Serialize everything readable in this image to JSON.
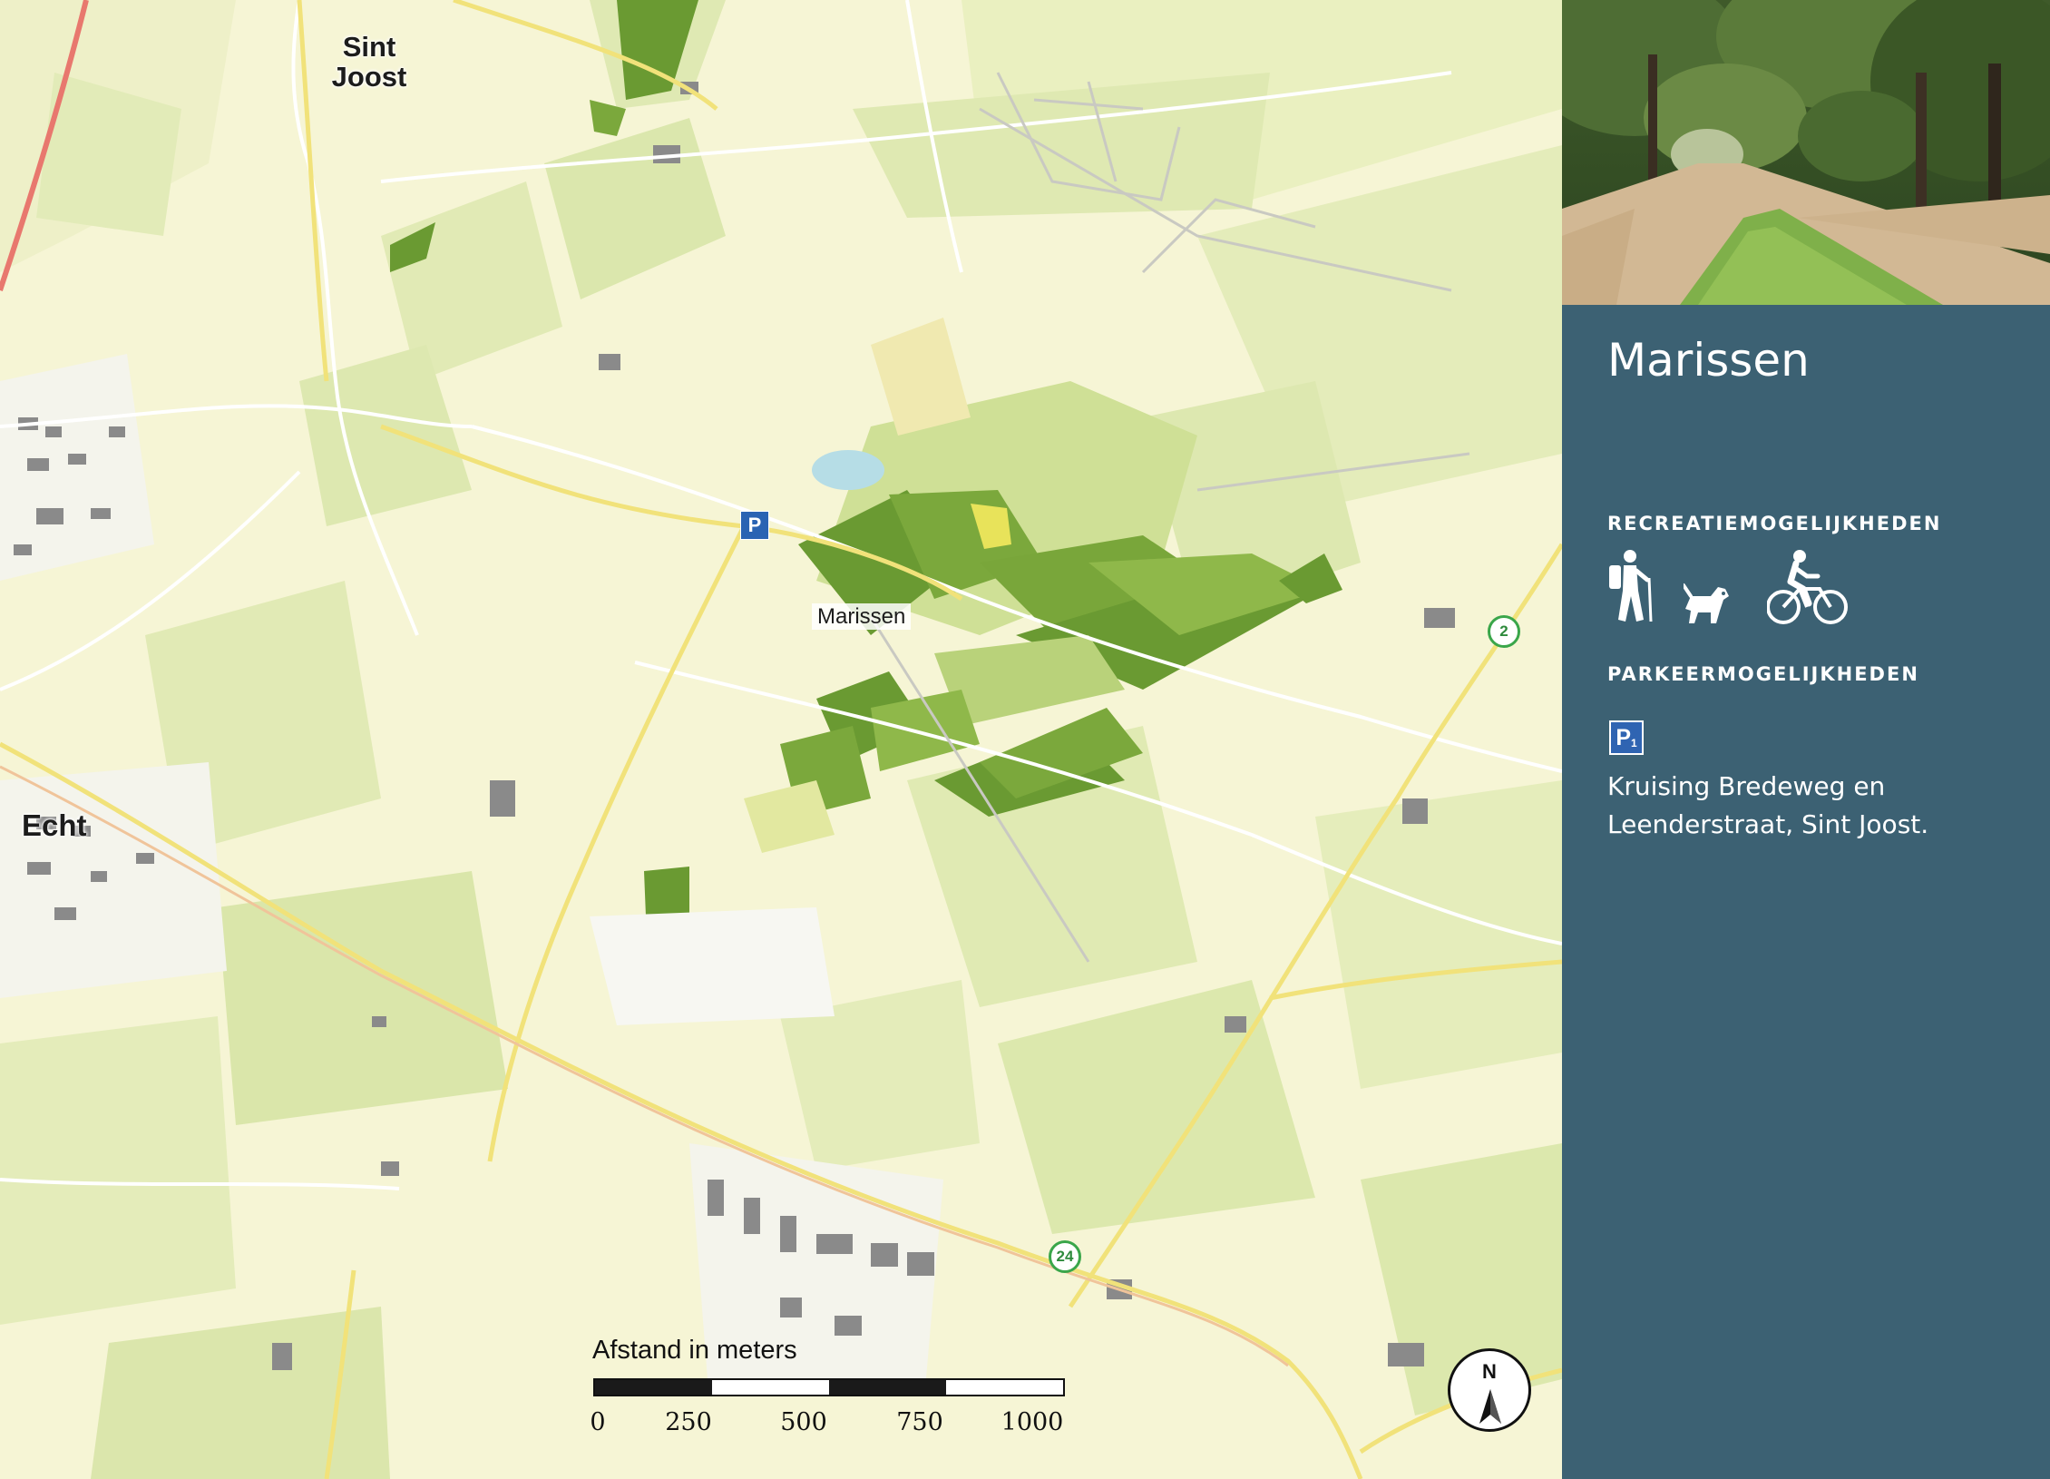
{
  "map": {
    "places": {
      "sint_joost": "Sint Joost",
      "echt": "Echt",
      "marissen": "Marissen"
    },
    "parking_marker": "P",
    "route_nodes": [
      "2",
      "24"
    ],
    "scale": {
      "title": "Afstand in meters",
      "ticks": [
        "0",
        "250",
        "500",
        "750",
        "1000"
      ]
    },
    "compass": "N"
  },
  "panel": {
    "title": "Marissen",
    "recreation_heading": "RECREATIEMOGELIJKHEDEN",
    "activity_icons": [
      "hiker-icon",
      "dog-walking-icon",
      "cyclist-icon"
    ],
    "parking_heading": "PARKEERMOGELIJKHEDEN",
    "parking_badge": "P",
    "parking_badge_sub": "1",
    "parking_address_line1": "Kruising Bredeweg en",
    "parking_address_line2": "Leenderstraat, Sint Joost."
  },
  "colors": {
    "panel_bg": "#3c6173",
    "map_bg": "#f6f5d5",
    "forest_dark": "#6a9a32",
    "forest_light": "#b9d27a",
    "parking_blue": "#2a63b3"
  }
}
